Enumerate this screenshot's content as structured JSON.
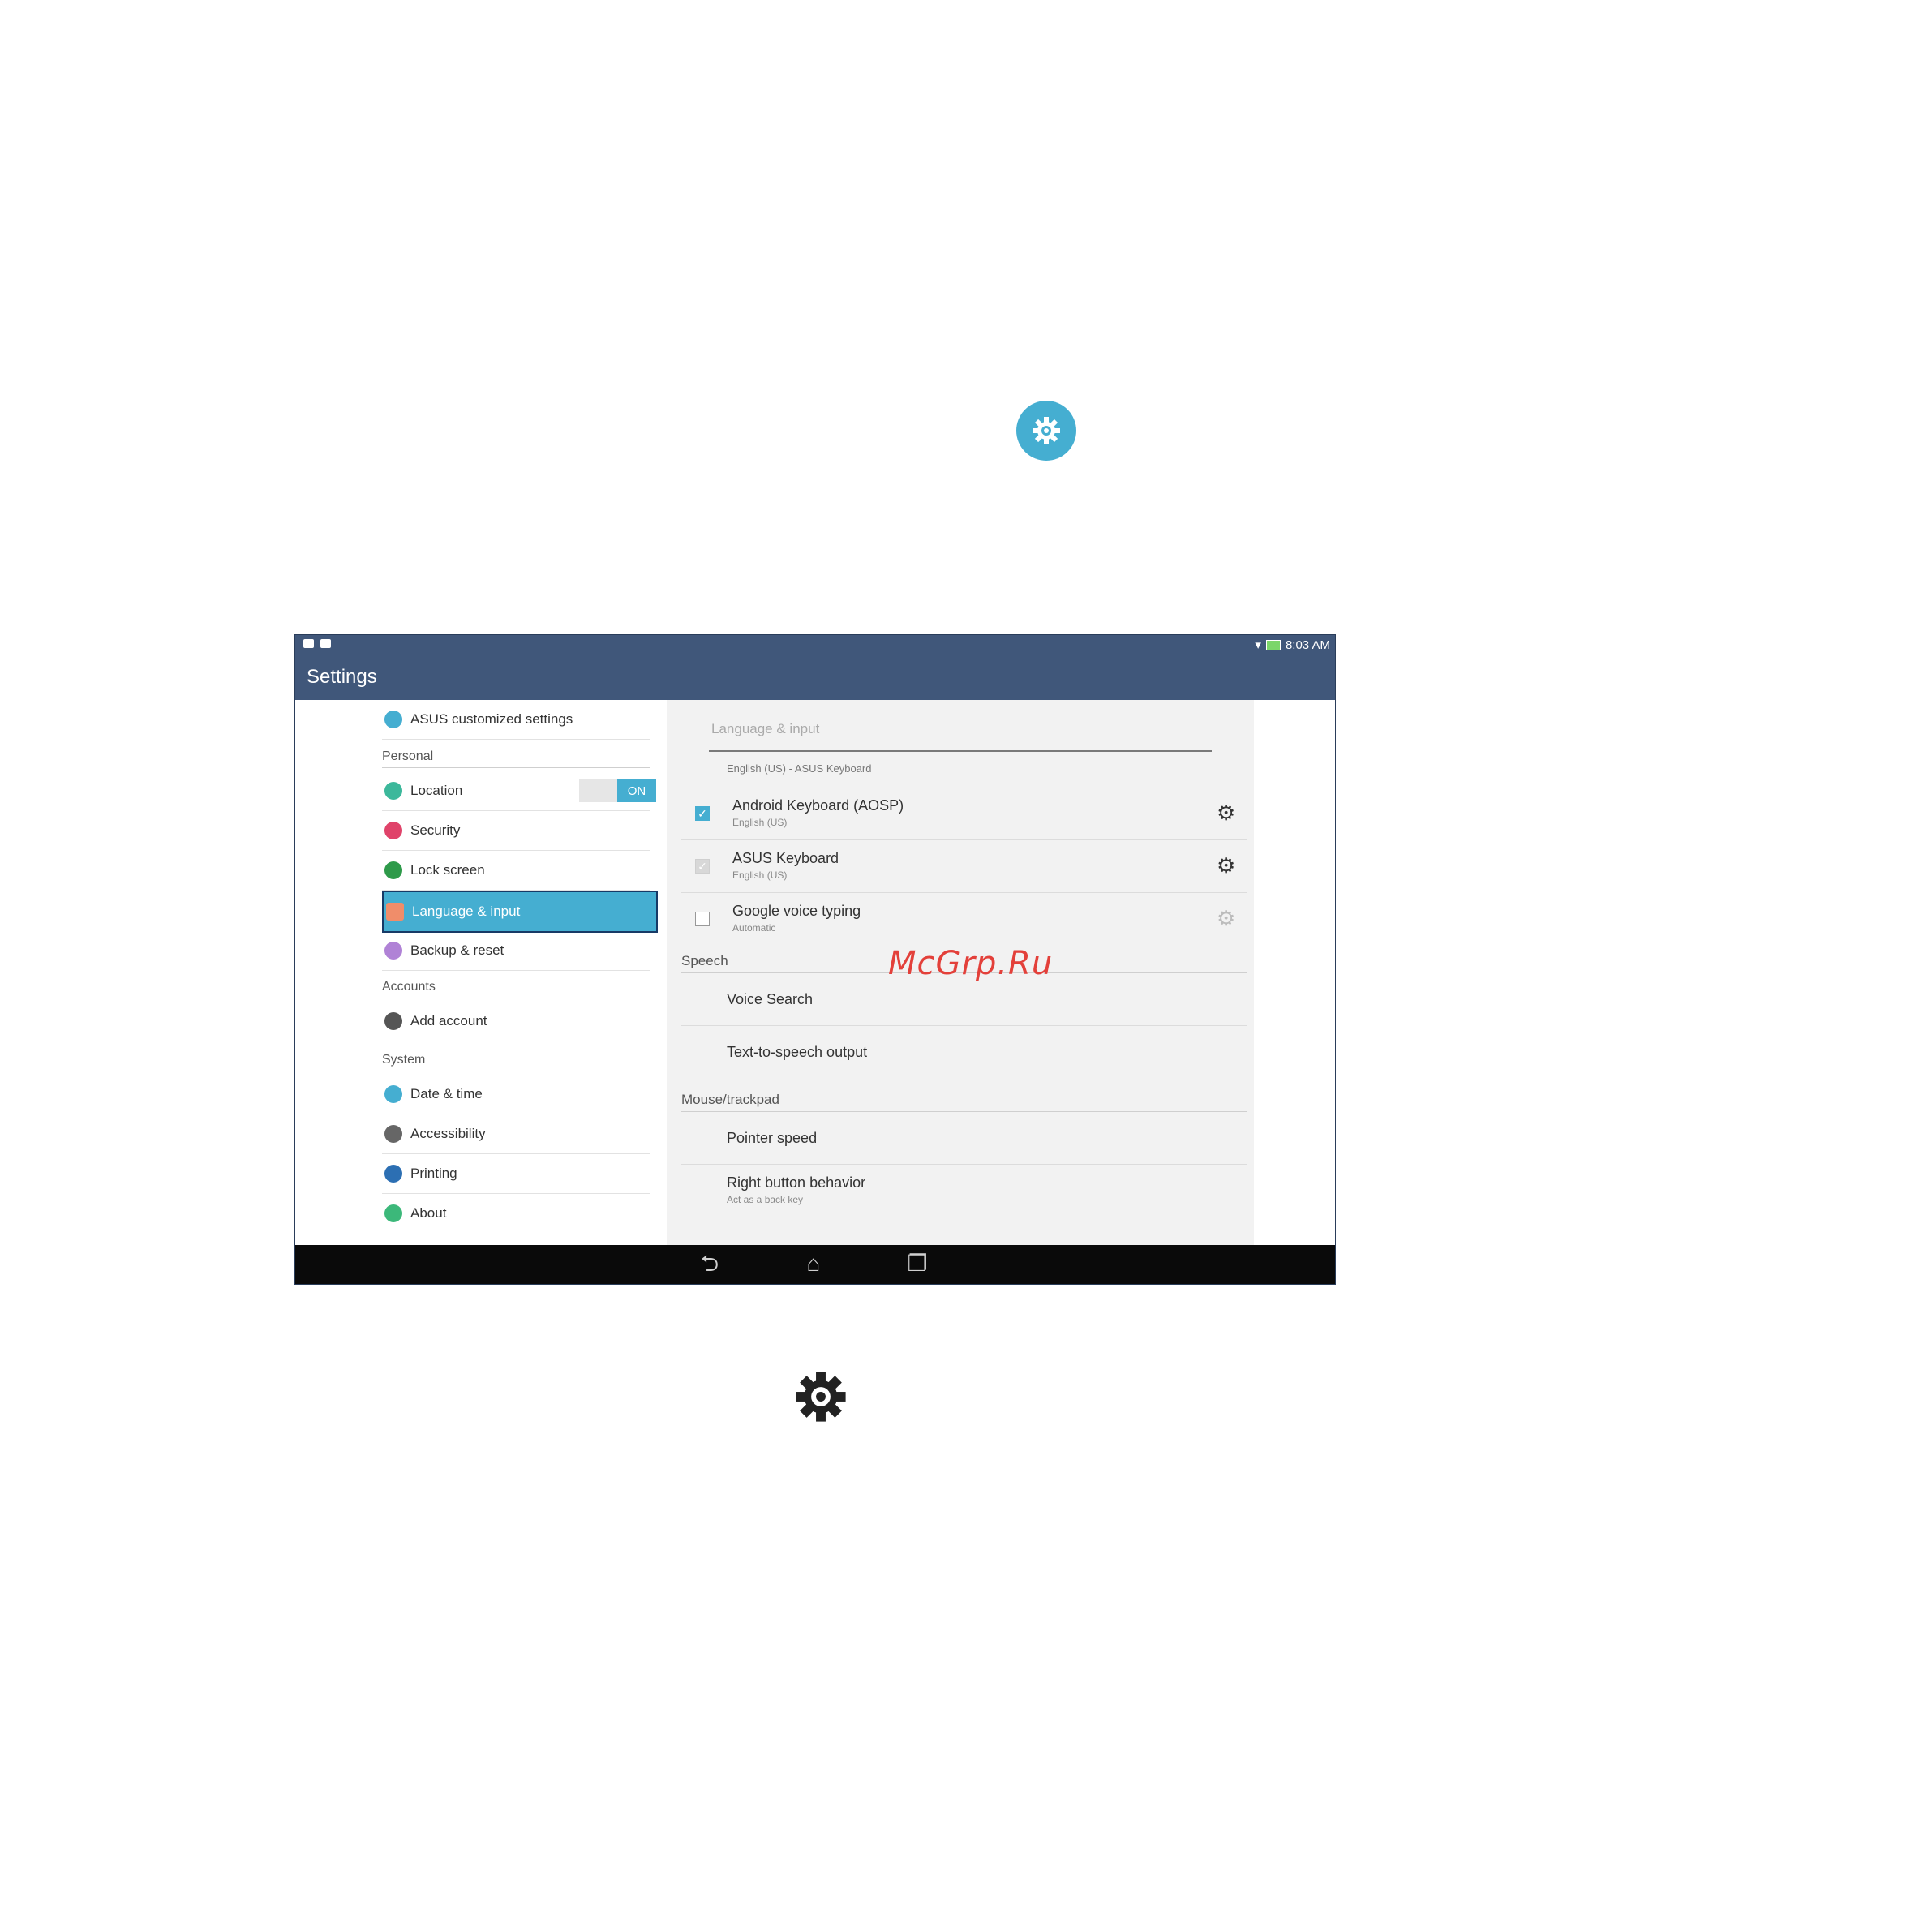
{
  "status_bar": {
    "time": "8:03 AM"
  },
  "action_bar": {
    "title": "Settings"
  },
  "left_menu": {
    "asus_settings": "ASUS customized settings",
    "personal_header": "Personal",
    "location": "Location",
    "location_toggle": "ON",
    "security": "Security",
    "lock_screen": "Lock screen",
    "language_input": "Language & input",
    "backup_reset": "Backup & reset",
    "accounts_header": "Accounts",
    "add_account": "Add account",
    "system_header": "System",
    "date_time": "Date & time",
    "accessibility": "Accessibility",
    "printing": "Printing",
    "about": "About"
  },
  "right_pane": {
    "title": "Language & input",
    "default_keyboard": "English (US) - ASUS Keyboard",
    "keyboards": [
      {
        "name": "Android Keyboard (AOSP)",
        "sub": "English (US)",
        "checked": true
      },
      {
        "name": "ASUS Keyboard",
        "sub": "English (US)",
        "checked": true
      },
      {
        "name": "Google voice typing",
        "sub": "Automatic",
        "checked": false
      }
    ],
    "speech_header": "Speech",
    "voice_search": "Voice Search",
    "tts_output": "Text-to-speech output",
    "mouse_header": "Mouse/trackpad",
    "pointer_speed": "Pointer speed",
    "right_button": "Right button behavior",
    "right_button_sub": "Act as a back key"
  },
  "watermark": "McGrp.Ru",
  "icons": {
    "settings_circle": "gear-icon",
    "gear": "gear-icon",
    "back": "back-icon",
    "home": "home-icon",
    "recents": "recents-icon"
  },
  "colors": {
    "accent": "#45aed1",
    "actionbar": "#40577a",
    "navbar": "#0a0a0a",
    "watermark": "#e3403a"
  }
}
